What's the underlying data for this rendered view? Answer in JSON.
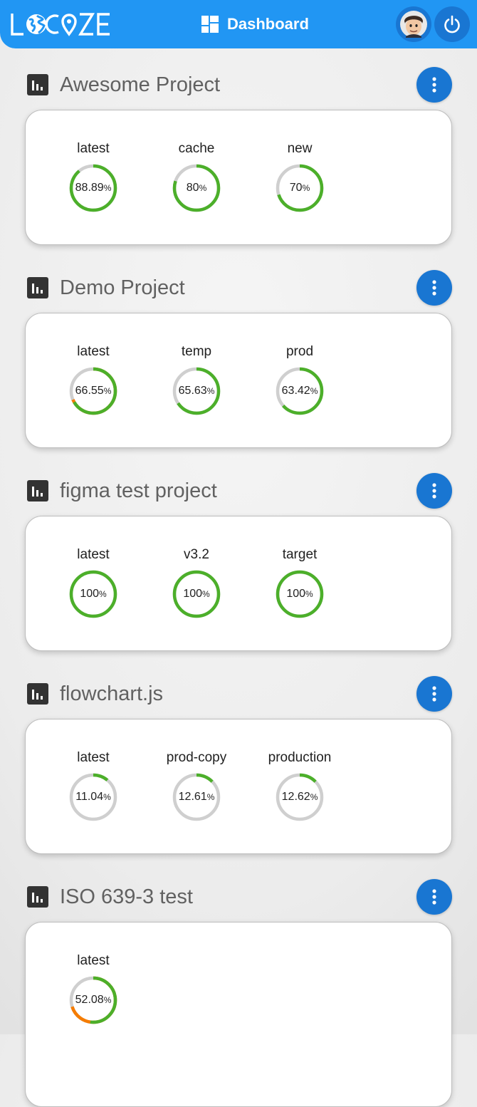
{
  "app": {
    "logo_text": "LOCIZE",
    "nav_label": "Dashboard"
  },
  "colors": {
    "primary": "#2196f3",
    "primary_dark": "#1976d2",
    "ring_track": "#cfcfcf",
    "ring_translated": "#4caf2a",
    "ring_warning": "#f57c00"
  },
  "projects": [
    {
      "title": "Awesome Project",
      "versions": [
        {
          "name": "latest",
          "percent": "88.89",
          "value": 88.89,
          "warning": 0
        },
        {
          "name": "cache",
          "percent": "80",
          "value": 80,
          "warning": 0
        },
        {
          "name": "new",
          "percent": "70",
          "value": 70,
          "warning": 0
        }
      ]
    },
    {
      "title": "Demo Project",
      "versions": [
        {
          "name": "latest",
          "percent": "66.55",
          "value": 66.55,
          "warning": 2
        },
        {
          "name": "temp",
          "percent": "65.63",
          "value": 65.63,
          "warning": 0
        },
        {
          "name": "prod",
          "percent": "63.42",
          "value": 63.42,
          "warning": 0
        }
      ]
    },
    {
      "title": "figma test project",
      "versions": [
        {
          "name": "latest",
          "percent": "100",
          "value": 100,
          "warning": 0
        },
        {
          "name": "v3.2",
          "percent": "100",
          "value": 100,
          "warning": 0
        },
        {
          "name": "target",
          "percent": "100",
          "value": 100,
          "warning": 0
        }
      ]
    },
    {
      "title": "flowchart.js",
      "versions": [
        {
          "name": "latest",
          "percent": "11.04",
          "value": 11.04,
          "warning": 0
        },
        {
          "name": "prod-copy",
          "percent": "12.61",
          "value": 12.61,
          "warning": 0
        },
        {
          "name": "production",
          "percent": "12.62",
          "value": 12.62,
          "warning": 0
        }
      ]
    },
    {
      "title": "ISO 639-3 test",
      "versions": [
        {
          "name": "latest",
          "percent": "52.08",
          "value": 52.08,
          "warning": 18
        }
      ]
    }
  ],
  "percent_suffix": "%"
}
